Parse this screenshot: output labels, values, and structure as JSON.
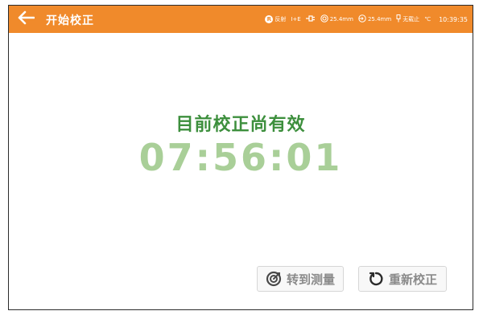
{
  "header": {
    "title": "开始校正",
    "status": {
      "r_badge": "R",
      "r_label": "反射",
      "mode": "I+E",
      "aperture": "25.4mm",
      "aperture2": "25.4mm",
      "device": "无载止",
      "temp_unit": "℃",
      "time": "10:39:35"
    }
  },
  "main": {
    "message": "目前校正尚有效",
    "countdown": "07:56:01"
  },
  "actions": {
    "measure_label": "转到测量",
    "recalibrate_label": "重新校正"
  },
  "colors": {
    "header_bg": "#f08a2b",
    "message": "#3d8f3d",
    "countdown": "#a9cf98"
  }
}
